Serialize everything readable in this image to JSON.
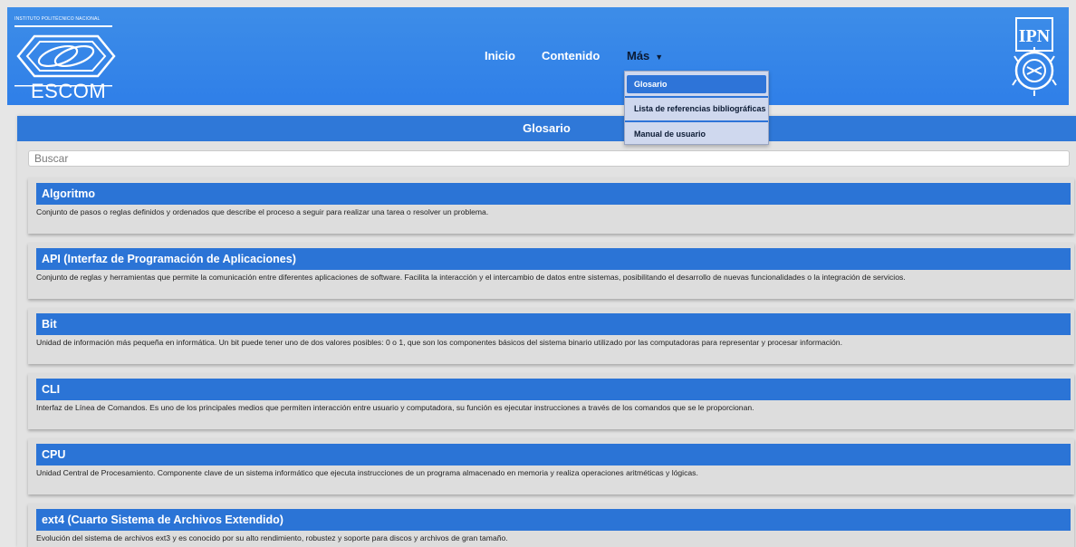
{
  "header": {
    "institution": "INSTITUTO POLITÉCNICO NACIONAL",
    "school_logo_text": "ESCOM",
    "ipn_logo_text": "IPN"
  },
  "nav": {
    "inicio": "Inicio",
    "contenido": "Contenido",
    "mas": "Más"
  },
  "dropdown": {
    "items": [
      "Glosario",
      "Lista de referencias bibliográficas",
      "Manual de usuario"
    ],
    "active": "Glosario"
  },
  "main": {
    "title": "Glosario",
    "search_placeholder": "Buscar"
  },
  "terms": [
    {
      "name": "Algoritmo",
      "description": "Conjunto de pasos o reglas definidos y ordenados que describe el proceso a seguir para realizar una tarea o resolver un problema."
    },
    {
      "name": "API (Interfaz de Programación de Aplicaciones)",
      "description": "Conjunto de reglas y herramientas que permite la comunicación entre diferentes aplicaciones de software. Facilita la interacción y el intercambio de datos entre sistemas, posibilitando el desarrollo de nuevas funcionalidades o la integración de servicios."
    },
    {
      "name": "Bit",
      "description": "Unidad de información más pequeña en informática. Un bit puede tener uno de dos valores posibles: 0 o 1, que son los componentes básicos del sistema binario utilizado por las computadoras para representar y procesar información."
    },
    {
      "name": "CLI",
      "description": "Interfaz de Línea de Comandos. Es uno de los principales medios que permiten interacción entre usuario y computadora, su función es ejecutar instrucciones a través de los comandos que se le proporcionan."
    },
    {
      "name": "CPU",
      "description": "Unidad Central de Procesamiento. Componente clave de un sistema informático que ejecuta instrucciones de un programa almacenado en memoria y realiza operaciones aritméticas y lógicas."
    },
    {
      "name": "ext4 (Cuarto Sistema de Archivos Extendido)",
      "description": "Evolución del sistema de archivos ext3 y es conocido por su alto rendimiento, robustez y soporte para discos y archivos de gran tamaño."
    }
  ],
  "colors": {
    "header_blue": "#3d8de8",
    "term_header_blue": "#2b74d6",
    "page_bg": "#e6e6e6"
  }
}
